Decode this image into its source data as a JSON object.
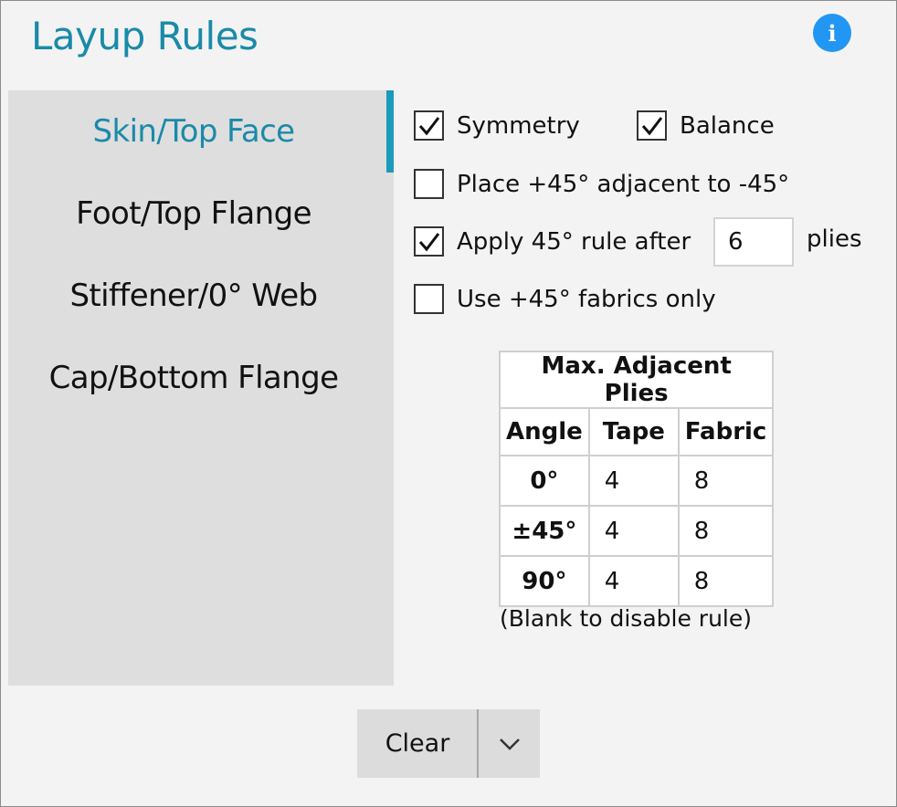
{
  "window": {
    "title": "Layup Rules"
  },
  "info_icon": {
    "glyph": "i",
    "color": "#2196f3"
  },
  "sidebar": {
    "items": [
      {
        "label": "Skin/Top Face",
        "active": true
      },
      {
        "label": "Foot/Top Flange",
        "active": false
      },
      {
        "label": "Stiffener/0° Web",
        "active": false
      },
      {
        "label": "Cap/Bottom Flange",
        "active": false
      }
    ],
    "accent": "#1a8aa8"
  },
  "options": {
    "symmetry": {
      "label": "Symmetry",
      "checked": true
    },
    "balance": {
      "label": "Balance",
      "checked": true
    },
    "place_adjacent": {
      "label": "Place +45° adjacent to -45°",
      "checked": false
    },
    "apply_rule": {
      "label": "Apply 45° rule after",
      "checked": true,
      "value": "6",
      "suffix": "plies"
    },
    "fabrics_only": {
      "label": "Use +45° fabrics only",
      "checked": false
    }
  },
  "table": {
    "title": "Max. Adjacent Plies",
    "headers": [
      "Angle",
      "Tape",
      "Fabric"
    ],
    "rows": [
      {
        "angle": "0°",
        "tape": "4",
        "fabric": "8"
      },
      {
        "angle": "±45°",
        "tape": "4",
        "fabric": "8"
      },
      {
        "angle": "90°",
        "tape": "4",
        "fabric": "8"
      }
    ],
    "note": "(Blank to disable rule)"
  },
  "footer": {
    "clear_label": "Clear"
  }
}
